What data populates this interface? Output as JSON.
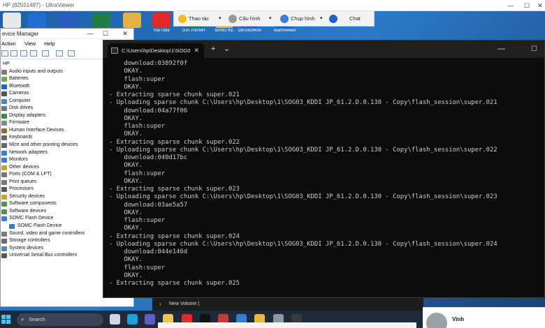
{
  "ultraviewer": {
    "title": "HP (82551497) - UltraViewer",
    "controls": [
      "—",
      "☐",
      "✕"
    ],
    "toolbar": {
      "actions_label": "Thao tác",
      "config_label": "Cấu hình",
      "capture_label": "Chụp hình",
      "chat_label": "Chat",
      "dropdown_glyph": "▾"
    }
  },
  "desktop": {
    "icons": [
      {
        "label": "",
        "color": "#e8e8e8"
      },
      {
        "label": "",
        "color": "#1f6fd1"
      },
      {
        "label": "",
        "color": "#2b5cbf"
      },
      {
        "label": "",
        "color": "#1e7e45"
      },
      {
        "label": "h",
        "color": "#e3b341"
      },
      {
        "label": "YouTube",
        "color": "#e12a2a"
      },
      {
        "label": "GIA THANH",
        "color": "#1e7e45"
      },
      {
        "label": "BANG KE",
        "color": "#e3b341"
      },
      {
        "label": "1801429439",
        "color": "#2b5cbf"
      },
      {
        "label": "TeamViewer",
        "color": "#0e66c9"
      }
    ]
  },
  "device_manager": {
    "title": "evice Manager",
    "controls": [
      "—",
      "☐",
      "✕"
    ],
    "menu": [
      "Action",
      "View",
      "Help"
    ],
    "tree": [
      {
        "label": "HP",
        "level": "root",
        "color": "#6a8fbf"
      },
      {
        "label": "Audio inputs and outputs",
        "level": "child",
        "color": "#7c7c7c"
      },
      {
        "label": "Batteries",
        "level": "child",
        "color": "#6ab04c"
      },
      {
        "label": "Bluetooth",
        "level": "child",
        "color": "#1e63c8"
      },
      {
        "label": "Cameras",
        "level": "child",
        "color": "#555"
      },
      {
        "label": "Computer",
        "level": "child",
        "color": "#4a86c8"
      },
      {
        "label": "Disk drives",
        "level": "child",
        "color": "#777"
      },
      {
        "label": "Display adapters",
        "level": "child",
        "color": "#3c8e3c"
      },
      {
        "label": "Firmware",
        "level": "child",
        "color": "#888"
      },
      {
        "label": "Human Interface Devices",
        "level": "child",
        "color": "#8a6d3b"
      },
      {
        "label": "Keyboards",
        "level": "child",
        "color": "#666"
      },
      {
        "label": "Mice and other pointing devices",
        "level": "child",
        "color": "#666"
      },
      {
        "label": "Network adapters",
        "level": "child",
        "color": "#3a7bd5"
      },
      {
        "label": "Monitors",
        "level": "child",
        "color": "#3a7bd5"
      },
      {
        "label": "Other devices",
        "level": "child",
        "color": "#c9a227"
      },
      {
        "label": "Ports (COM & LPT)",
        "level": "child",
        "color": "#777"
      },
      {
        "label": "Print queues",
        "level": "child",
        "color": "#777"
      },
      {
        "label": "Processors",
        "level": "child",
        "color": "#5a5a5a"
      },
      {
        "label": "Security devices",
        "level": "child",
        "color": "#c9a227"
      },
      {
        "label": "Software components",
        "level": "child",
        "color": "#5a8a5a"
      },
      {
        "label": "Software devices",
        "level": "child",
        "color": "#5a8a5a"
      },
      {
        "label": "SOMC Flash Device",
        "level": "child",
        "color": "#3a7bd5"
      },
      {
        "label": "SOMC Flash Device",
        "level": "grand",
        "color": "#3a7bd5"
      },
      {
        "label": "Sound, video and game controllers",
        "level": "child",
        "color": "#7c7c7c"
      },
      {
        "label": "Storage controllers",
        "level": "child",
        "color": "#6a6a6a"
      },
      {
        "label": "System devices",
        "level": "child",
        "color": "#4a86c8"
      },
      {
        "label": "Universal Serial Bus controllers",
        "level": "child",
        "color": "#555"
      }
    ]
  },
  "terminal": {
    "tab_title": "C:\\Users\\hp\\Desktop\\1\\SOG0",
    "close_glyph": "✕",
    "new_tab_glyph": "+",
    "dropdown_glyph": "⌄",
    "controls": [
      "—",
      "☐"
    ],
    "lines": [
      "    download:03892f0f",
      "    OKAY.",
      "    flash:super",
      "    OKAY.",
      "- Extracting sparse chunk super.021",
      "- Uploading sparse chunk C:\\Users\\hp\\Desktop\\1\\SOG03_KDDI JP_61.2.D.0.130 - Copy\\flash_session\\super.021",
      "    download:04a77f06",
      "    OKAY.",
      "    flash:super",
      "    OKAY.",
      "- Extracting sparse chunk super.022",
      "- Uploading sparse chunk C:\\Users\\hp\\Desktop\\1\\SOG03_KDDI JP_61.2.D.0.130 - Copy\\flash_session\\super.022",
      "    download:040d17bc",
      "    OKAY.",
      "    flash:super",
      "    OKAY.",
      "- Extracting sparse chunk super.023",
      "- Uploading sparse chunk C:\\Users\\hp\\Desktop\\1\\SOG03_KDDI JP_61.2.D.0.130 - Copy\\flash_session\\super.023",
      "    download:03ae5a57",
      "    OKAY.",
      "    flash:super",
      "    OKAY.",
      "- Extracting sparse chunk super.024",
      "- Uploading sparse chunk C:\\Users\\hp\\Desktop\\1\\SOG03_KDDI JP_61.2.D.0.130 - Copy\\flash_session\\super.024",
      "    download:044e146d",
      "    OKAY.",
      "    flash:super",
      "    OKAY.",
      "- Extracting sparse chunk super.025"
    ]
  },
  "explorer": {
    "nav_item": "New Volume (",
    "expand_glyph": "›"
  },
  "comment": {
    "author": "Vinh"
  },
  "taskbar": {
    "search_label": "Search",
    "search_glyph": "⌕",
    "apps": [
      {
        "name": "task-view",
        "color": "#cfd6df"
      },
      {
        "name": "edge",
        "color": "#1fa0d8"
      },
      {
        "name": "teams",
        "color": "#5b5fc7"
      },
      {
        "name": "file-explorer",
        "color": "#f2c14e"
      },
      {
        "name": "youtube",
        "color": "#e12a2a"
      },
      {
        "name": "tiktok",
        "color": "#111"
      },
      {
        "name": "app-red",
        "color": "#c23b3b"
      },
      {
        "name": "app-blue",
        "color": "#2d7fd3"
      },
      {
        "name": "chrome",
        "color": "#e5b93a"
      },
      {
        "name": "app-grey",
        "color": "#8d96a3"
      },
      {
        "name": "terminal",
        "color": "#3a3a3a"
      }
    ]
  }
}
